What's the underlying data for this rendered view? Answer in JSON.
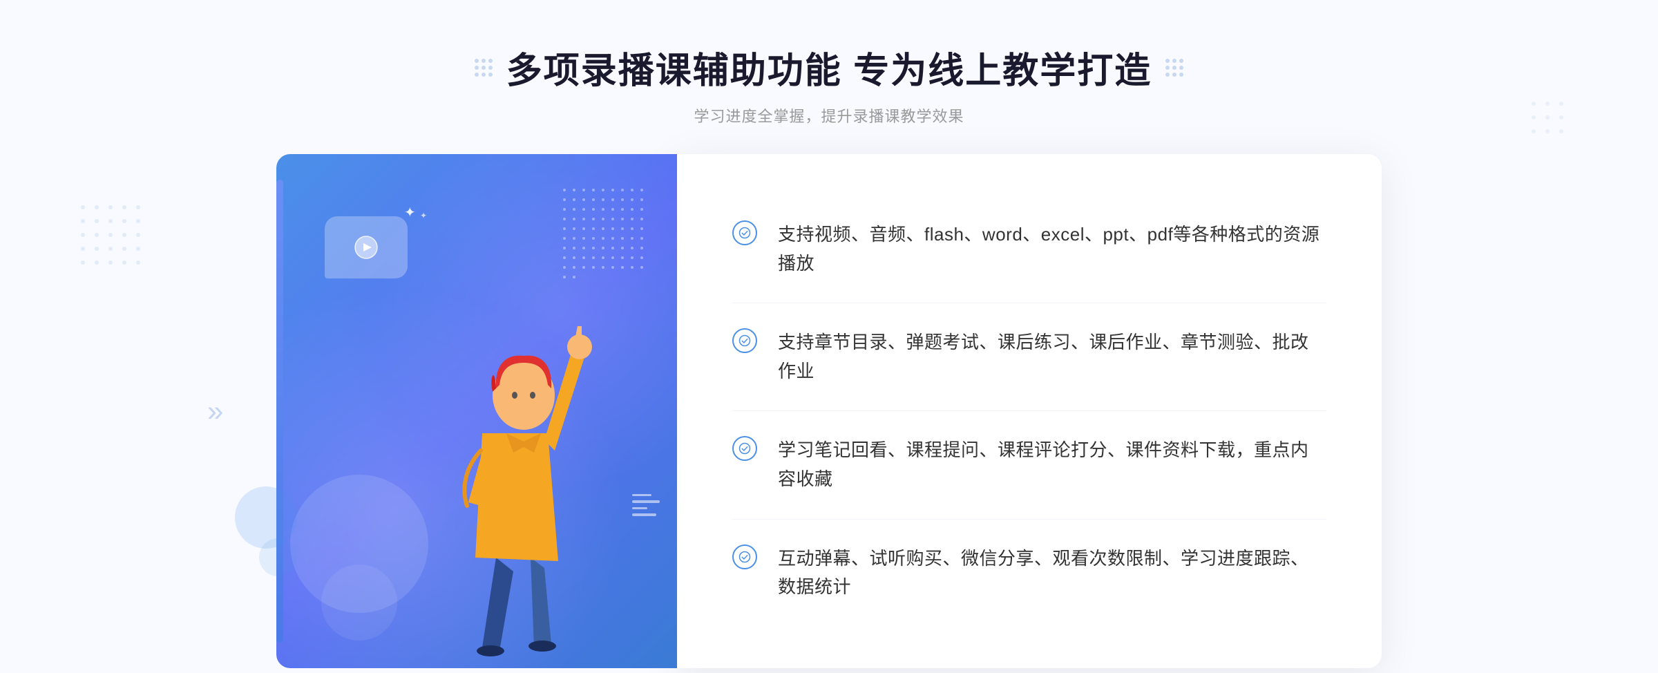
{
  "page": {
    "bg_color": "#f7f9ff"
  },
  "header": {
    "title": "多项录播课辅助功能 专为线上教学打造",
    "subtitle": "学习进度全掌握，提升录播课教学效果"
  },
  "features": [
    {
      "id": 1,
      "text": "支持视频、音频、flash、word、excel、ppt、pdf等各种格式的资源播放"
    },
    {
      "id": 2,
      "text": "支持章节目录、弹题考试、课后练习、课后作业、章节测验、批改作业"
    },
    {
      "id": 3,
      "text": "学习笔记回看、课程提问、课程评论打分、课件资料下载，重点内容收藏"
    },
    {
      "id": 4,
      "text": "互动弹幕、试听购买、微信分享、观看次数限制、学习进度跟踪、数据统计"
    }
  ],
  "decorative": {
    "chevron": "»"
  }
}
